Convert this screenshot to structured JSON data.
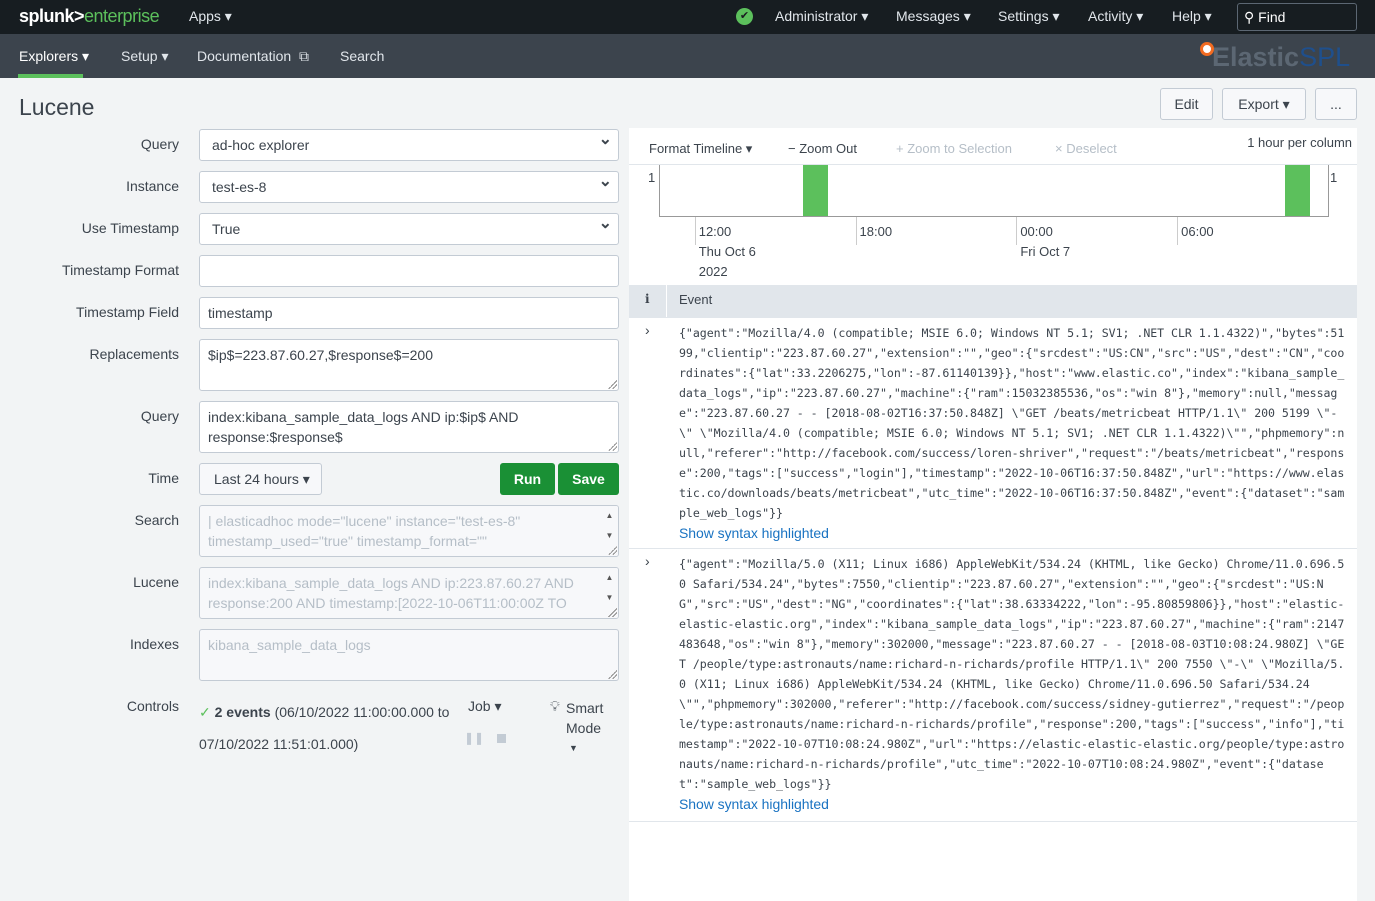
{
  "topbar": {
    "logo_main": "splunk>",
    "logo_sub": "enterprise",
    "apps": "Apps ▾",
    "user": "Administrator ▾",
    "messages": "Messages ▾",
    "settings": "Settings ▾",
    "activity": "Activity ▾",
    "help": "Help ▾",
    "find": "Find",
    "status_icon": "check-circle-icon",
    "status_color": "#5cc05c"
  },
  "appbar": {
    "items": [
      "Explorers ▾",
      "Setup ▾",
      "Documentation",
      "Search"
    ],
    "ext_icon": "⧉",
    "brand_a": "Elastic",
    "brand_b": "SPL",
    "accent": "#5cc05c"
  },
  "page": {
    "title": "Lucene",
    "edit": "Edit",
    "export": "Export ▾",
    "more": "..."
  },
  "form": {
    "query_label": "Query",
    "query_value": "ad-hoc explorer",
    "instance_label": "Instance",
    "instance_value": "test-es-8",
    "use_ts_label": "Use Timestamp",
    "use_ts_value": "True",
    "ts_format_label": "Timestamp Format",
    "ts_format_value": "",
    "ts_field_label": "Timestamp Field",
    "ts_field_value": "timestamp",
    "repl_label": "Replacements",
    "repl_value": "$ip$=223.87.60.27,$response$=200",
    "query2_label": "Query",
    "query2_value": "index:kibana_sample_data_logs AND ip:$ip$ AND response:$response$",
    "time_label": "Time",
    "time_value": "Last 24 hours ▾",
    "run": "Run",
    "save": "Save",
    "search_label": "Search",
    "search_value": "| elasticadhoc mode=\"lucene\" instance=\"test-es-8\" timestamp_used=\"true\" timestamp_format=\"\"",
    "lucene_label": "Lucene",
    "lucene_value": "index:kibana_sample_data_logs AND ip:223.87.60.27 AND response:200 AND timestamp:[2022-10-06T11:00:00Z TO",
    "indexes_label": "Indexes",
    "indexes_value": "kibana_sample_data_logs",
    "controls_label": "Controls",
    "events_count": "2 events",
    "events_range": "(06/10/2022 11:00:00.000 to 07/10/2022 11:51:01.000)",
    "job": "Job ▾",
    "smart_mode": "Smart Mode"
  },
  "timeline": {
    "format": "Format Timeline ▾",
    "zoom_out": "− Zoom Out",
    "zoom_sel": "+ Zoom to Selection",
    "deselect": "× Deselect",
    "scale": "1 hour per column",
    "ymax_left": "1",
    "ymax_right": "1",
    "ticks": [
      {
        "t": "12:00",
        "d": "Thu Oct 6",
        "y": "2022"
      },
      {
        "t": "18:00",
        "d": "",
        "y": ""
      },
      {
        "t": "00:00",
        "d": "Fri Oct 7",
        "y": ""
      },
      {
        "t": "06:00",
        "d": "",
        "y": ""
      }
    ],
    "bar_color": "#5cc05c",
    "bars": [
      {
        "hour": "2022-10-06 16:00",
        "count": 1
      },
      {
        "hour": "2022-10-07 10:00",
        "count": 1
      }
    ]
  },
  "events": {
    "col_i": "i",
    "col_event": "Event",
    "show_syntax": "Show syntax highlighted",
    "rows": [
      "{\"agent\":\"Mozilla/4.0 (compatible; MSIE 6.0; Windows NT 5.1; SV1; .NET CLR 1.1.4322)\",\"bytes\":5199,\"clientip\":\"223.87.60.27\",\"extension\":\"\",\"geo\":{\"srcdest\":\"US:CN\",\"src\":\"US\",\"dest\":\"CN\",\"coordinates\":{\"lat\":33.2206275,\"lon\":-87.61140139}},\"host\":\"www.elastic.co\",\"index\":\"kibana_sample_data_logs\",\"ip\":\"223.87.60.27\",\"machine\":{\"ram\":15032385536,\"os\":\"win 8\"},\"memory\":null,\"message\":\"223.87.60.27 - - [2018-08-02T16:37:50.848Z] \\\"GET /beats/metricbeat HTTP/1.1\\\" 200 5199 \\\"-\\\" \\\"Mozilla/4.0 (compatible; MSIE 6.0; Windows NT 5.1; SV1; .NET CLR 1.1.4322)\\\"\",\"phpmemory\":null,\"referer\":\"http://facebook.com/success/loren-shriver\",\"request\":\"/beats/metricbeat\",\"response\":200,\"tags\":[\"success\",\"login\"],\"timestamp\":\"2022-10-06T16:37:50.848Z\",\"url\":\"https://www.elastic.co/downloads/beats/metricbeat\",\"utc_time\":\"2022-10-06T16:37:50.848Z\",\"event\":{\"dataset\":\"sample_web_logs\"}}",
      "{\"agent\":\"Mozilla/5.0 (X11; Linux i686) AppleWebKit/534.24 (KHTML, like Gecko) Chrome/11.0.696.50 Safari/534.24\",\"bytes\":7550,\"clientip\":\"223.87.60.27\",\"extension\":\"\",\"geo\":{\"srcdest\":\"US:NG\",\"src\":\"US\",\"dest\":\"NG\",\"coordinates\":{\"lat\":38.63334222,\"lon\":-95.80859806}},\"host\":\"elastic-elastic-elastic.org\",\"index\":\"kibana_sample_data_logs\",\"ip\":\"223.87.60.27\",\"machine\":{\"ram\":2147483648,\"os\":\"win 8\"},\"memory\":302000,\"message\":\"223.87.60.27 - - [2018-08-03T10:08:24.980Z] \\\"GET /people/type:astronauts/name:richard-n-richards/profile HTTP/1.1\\\" 200 7550 \\\"-\\\" \\\"Mozilla/5.0 (X11; Linux i686) AppleWebKit/534.24 (KHTML, like Gecko) Chrome/11.0.696.50 Safari/534.24\\\"\",\"phpmemory\":302000,\"referer\":\"http://facebook.com/success/sidney-gutierrez\",\"request\":\"/people/type:astronauts/name:richard-n-richards/profile\",\"response\":200,\"tags\":[\"success\",\"info\"],\"timestamp\":\"2022-10-07T10:08:24.980Z\",\"url\":\"https://elastic-elastic-elastic.org/people/type:astronauts/name:richard-n-richards/profile\",\"utc_time\":\"2022-10-07T10:08:24.980Z\",\"event\":{\"dataset\":\"sample_web_logs\"}}"
    ]
  }
}
